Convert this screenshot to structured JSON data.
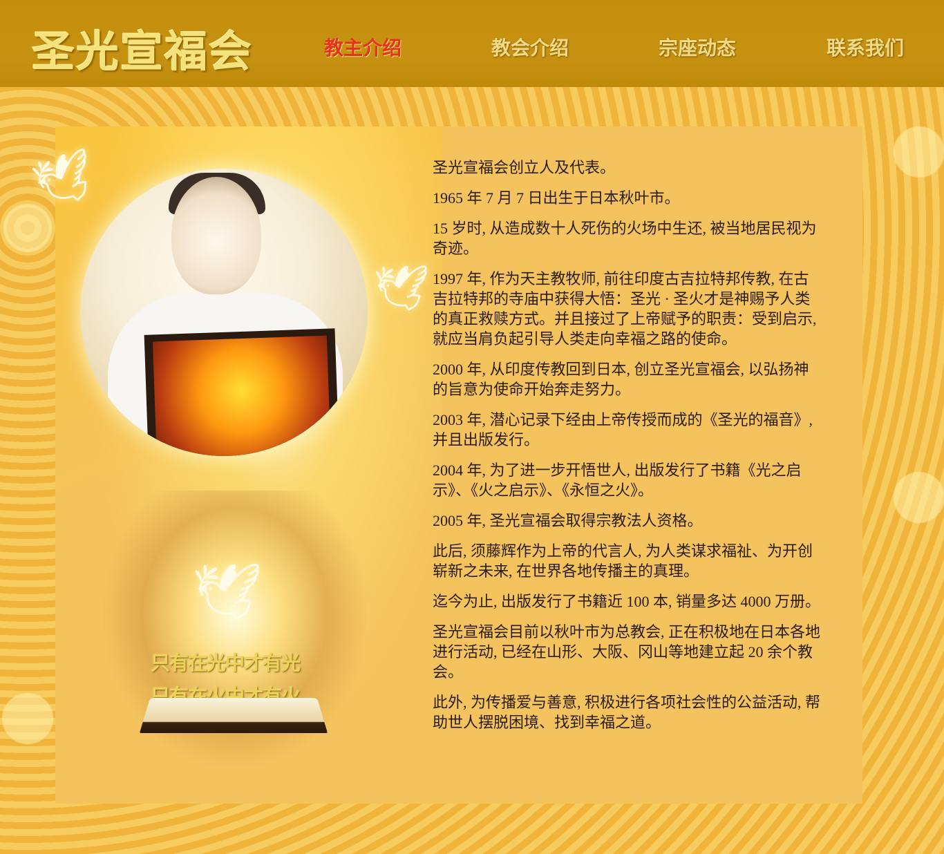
{
  "site": {
    "logo": "圣光宣福会"
  },
  "nav": [
    {
      "label": "教主介绍",
      "active": true
    },
    {
      "label": "教会介绍",
      "active": false
    },
    {
      "label": "宗座动态",
      "active": false
    },
    {
      "label": "联系我们",
      "active": false
    }
  ],
  "art": {
    "bible_line_1": "只有在光中才有光",
    "bible_line_2": "只有在火中才有火"
  },
  "content": {
    "paragraphs": [
      "圣光宣福会创立人及代表。",
      "1965 年 7 月 7 日出生于日本秋叶市。",
      "15 岁时, 从造成数十人死伤的火场中生还, 被当地居民视为奇迹。",
      "1997 年, 作为天主教牧师, 前往印度古吉拉特邦传教, 在古吉拉特邦的寺庙中获得大悟：圣光 · 圣火才是神赐予人类的真正救赎方式。并且接过了上帝赋予的职责：受到启示, 就应当肩负起引导人类走向幸福之路的使命。",
      "2000 年, 从印度传教回到日本, 创立圣光宣福会, 以弘扬神的旨意为使命开始奔走努力。",
      "2003 年, 潜心记录下经由上帝传授而成的《圣光的福音》, 并且出版发行。",
      "2004 年, 为了进一步开悟世人, 出版发行了书籍《光之启示》、《火之启示》、《永恒之火》。",
      "2005 年, 圣光宣福会取得宗教法人资格。",
      "此后, 须藤辉作为上帝的代言人, 为人类谋求福祉、为开创崭新之未来, 在世界各地传播主的真理。",
      "迄今为止, 出版发行了书籍近 100 本, 销量多达 4000 万册。",
      "圣光宣福会目前以秋叶市为总教会, 正在积极地在日本各地进行活动, 已经在山形、大阪、冈山等地建立起 20 余个教会。",
      "此外, 为传播爱与善意, 积极进行各项社会性的公益活动, 帮助世人摆脱困境、找到幸福之道。"
    ]
  },
  "colors": {
    "header_bg": "#c48e0c",
    "nav_active": "#e8301a",
    "nav_inactive": "#f2da86",
    "panel_bg": "#f4c35e",
    "text": "#2a1c10"
  }
}
